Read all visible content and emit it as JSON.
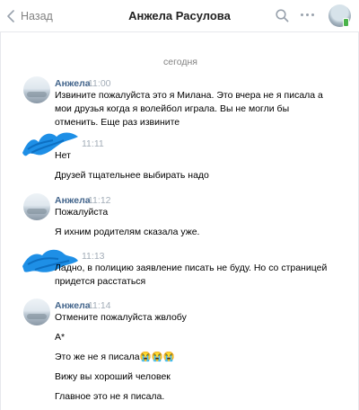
{
  "header": {
    "back_label": "Назад",
    "title": "Анжела Расулова"
  },
  "date_separator": "сегодня",
  "messages": [
    {
      "author": "Анжела",
      "time": "11:00",
      "lines": [
        "Извините пожалуйста это я Милана. Это вчера не я писала а",
        "мои друзья когда я волейбол играла. Вы не могли бы",
        "отменить. Еще раз извините"
      ]
    },
    {
      "author": "",
      "time": "11:11",
      "lines": [
        "Нет",
        "Друзей тщательнее выбирать надо"
      ]
    },
    {
      "author": "Анжела",
      "time": "11:12",
      "lines": [
        "Пожалуйста",
        "Я ихним родителям сказала уже."
      ]
    },
    {
      "author": "",
      "time": "11:13",
      "lines": [
        "Ладно, в полицию заявление писать не буду. Но со страницей",
        "придется расстаться"
      ]
    },
    {
      "author": "Анжела",
      "time": "11:14",
      "lines": [
        "Отмените пожалуйста жвлобу",
        "А*",
        "Это же не я писала😭😭😭",
        "Вижу вы хороший человек",
        "Главное это не я писала."
      ]
    }
  ],
  "colors": {
    "accent": "#42648b",
    "muted": "#828282",
    "time": "#a3adb8",
    "scribble": "#1e8fe6"
  }
}
